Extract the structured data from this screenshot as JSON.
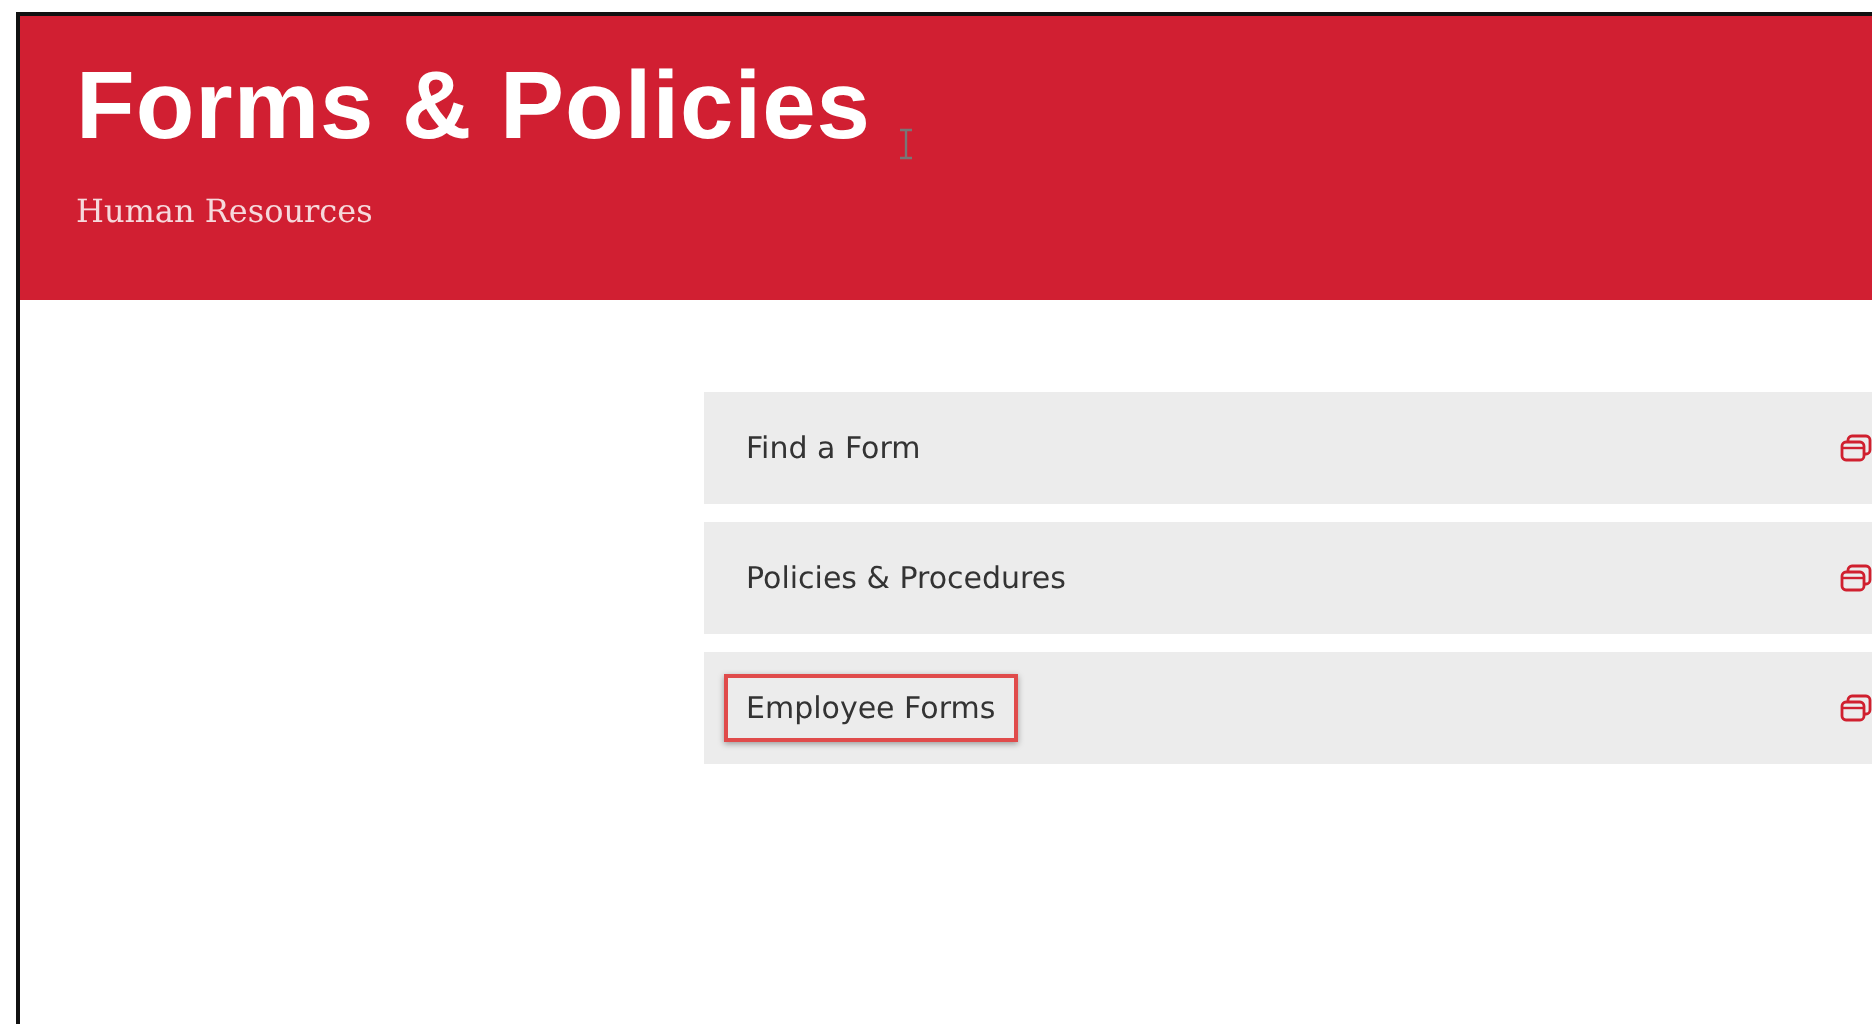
{
  "header": {
    "title": "Forms & Policies",
    "subtitle": "Human Resources"
  },
  "links": [
    {
      "label": "Find a Form",
      "highlighted": false
    },
    {
      "label": "Policies & Procedures",
      "highlighted": false
    },
    {
      "label": "Employee Forms",
      "highlighted": true
    }
  ]
}
